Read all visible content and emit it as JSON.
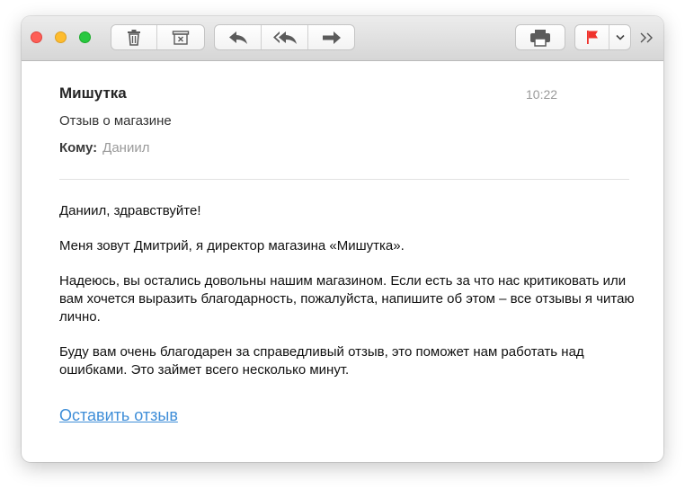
{
  "window": {
    "traffic_lights": {
      "close_color": "#fe5f57",
      "minimize_color": "#febc2e",
      "zoom_color": "#28c840"
    }
  },
  "toolbar": {
    "icons": {
      "delete": "trash-icon",
      "archive": "archive-icon",
      "reply": "reply-icon",
      "reply_all": "reply-all-icon",
      "forward": "forward-icon",
      "print": "printer-icon",
      "flag": "flag-icon",
      "flag_menu": "chevron-down-icon",
      "more": "chevron-double-right-icon"
    },
    "flag_color": "#f0322c"
  },
  "message": {
    "from": "Мишутка",
    "time": "10:22",
    "subject": "Отзыв о магазине",
    "to_label": "Кому:",
    "to_value": "Даниил"
  },
  "body": {
    "paragraphs": [
      "Даниил, здравствуйте!",
      "Меня зовут Дмитрий, я директор магазина «Мишутка».",
      "Надеюсь, вы остались довольны нашим магазином. Если есть за что нас критиковать или вам хочется выразить благодарность, пожалуйста, напишите об этом – все отзывы я читаю лично.",
      "Буду вам очень благодарен за справедливый отзыв, это поможет нам работать над ошибками. Это займет всего несколько минут."
    ],
    "cta_link": "Оставить отзыв",
    "link_color": "#3f8ed8"
  }
}
